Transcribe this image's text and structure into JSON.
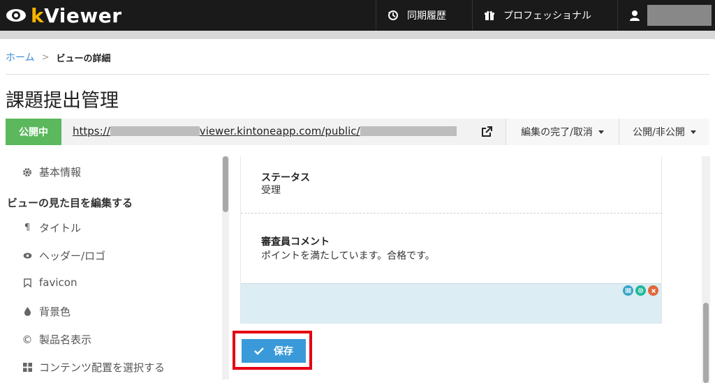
{
  "app": {
    "logo_prefix": "k",
    "logo_suffix": "Viewer",
    "nav": {
      "history_label": "同期履歴",
      "pro_label": "プロフェッショナル"
    }
  },
  "breadcrumb": {
    "home": "ホーム",
    "separator": ">",
    "current": "ビューの詳細"
  },
  "page": {
    "title": "課題提出管理"
  },
  "urlbar": {
    "status": "公開中",
    "url_prefix": "https://",
    "url_middle": "viewer.kintoneapp.com/public/",
    "edit_menu_label": "編集の完了/取消",
    "publish_menu_label": "公開/非公開"
  },
  "sidebar": {
    "basic_info": "基本情報",
    "section_heading": "ビューの見た目を編集する",
    "items": [
      {
        "label": "タイトル",
        "icon": "pilcrow-icon"
      },
      {
        "label": "ヘッダー/ロゴ",
        "icon": "eye-icon"
      },
      {
        "label": "favicon",
        "icon": "bookmark-icon"
      },
      {
        "label": "背景色",
        "icon": "drop-icon"
      },
      {
        "label": "製品名表示",
        "icon": "copyright-icon"
      },
      {
        "label": "コンテンツ配置を選択する",
        "icon": "grid-icon"
      }
    ]
  },
  "main": {
    "fields": [
      {
        "label": "ステータス",
        "value": "受理"
      },
      {
        "label": "審査員コメント",
        "value": "ポイントを満たしています。合格です。"
      }
    ]
  },
  "actions": {
    "save_label": "保存"
  },
  "colors": {
    "brand_yellow": "#f5b400",
    "published_green": "#5cb85c",
    "save_blue": "#3a9ad9",
    "highlight_red": "#e60012",
    "dropzone_blue": "#dcedf3"
  }
}
